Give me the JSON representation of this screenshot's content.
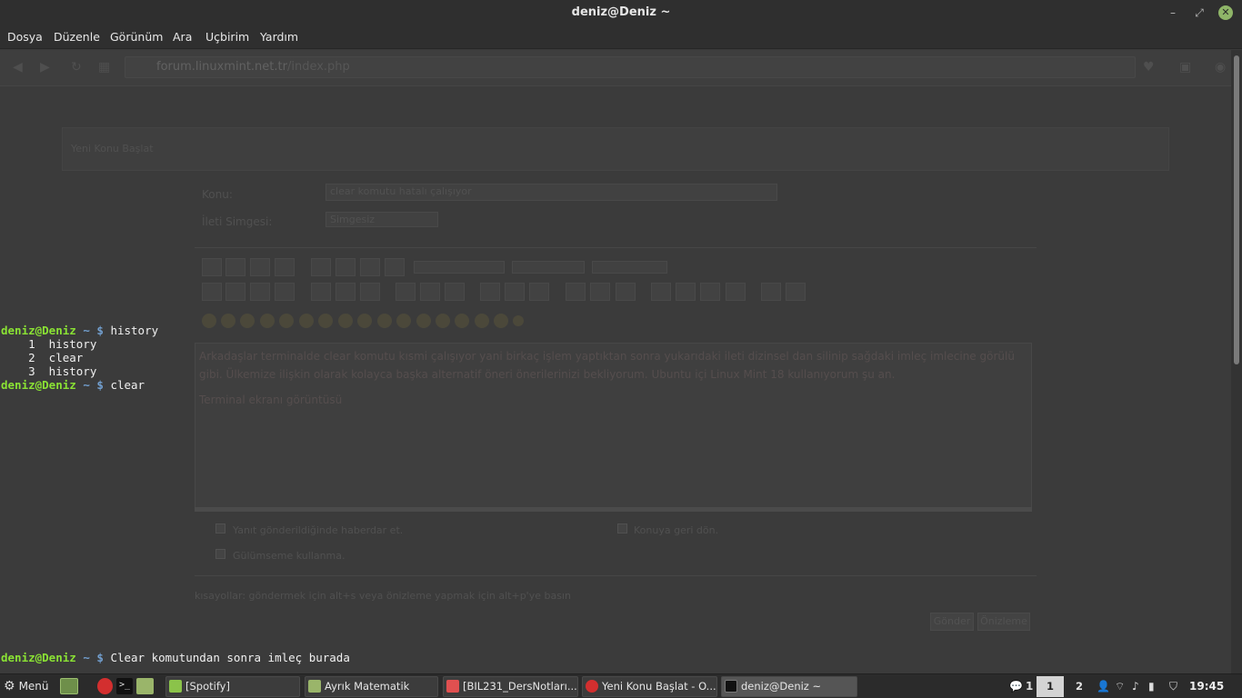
{
  "window": {
    "title": "deniz@Deniz ~",
    "minimize_glyph": "–",
    "maximize_glyph": "⤢",
    "close_glyph": "✕"
  },
  "menubar": {
    "items": [
      "Dosya",
      "Düzenle",
      "Görünüm",
      "Ara",
      "Uçbirim",
      "Yardım"
    ]
  },
  "background_browser": {
    "url_domain": "forum.linuxmint.net.tr",
    "url_path": "/index.php",
    "header_title": "Yeni Konu Başlat",
    "subject_label": "Konu:",
    "subject_value": "clear komutu hatalı çalışıyor",
    "icon_label": "İleti Simgesi:",
    "icon_value": "Simgesiz",
    "message_text": "Arkadaşlar terminalde clear komutu kısmi çalışıyor yani birkaç işlem yaptıktan sonra yukarıdaki ileti dizinsel dan silinip sağdaki imleç imlecine görülü gibi. Ülkemize ilişkin olarak kolayca başka alternatif öneri önerilerinizi bekliyorum. Ubuntu içi Linux Mint 18 kullanıyorum şu an.",
    "message_text2": "Terminal ekranı görüntüsü",
    "check1": "Yanıt gönderildiğinde haberdar et.",
    "check2": "Konuya geri dön.",
    "check3": "Gülümseme kullanma.",
    "shortcuts": "kısayollar: göndermek için alt+s veya önizleme yapmak için alt+p'ye basın",
    "send": "Gönder",
    "preview": "Önizleme"
  },
  "terminal": {
    "prompt_user": "deniz@Deniz",
    "prompt_dir": "~",
    "prompt_sym": "$",
    "lines": [
      {
        "type": "prompt",
        "cmd": "history"
      },
      {
        "type": "out",
        "text": "    1  history"
      },
      {
        "type": "out",
        "text": "    2  clear"
      },
      {
        "type": "out",
        "text": "    3  history"
      },
      {
        "type": "prompt",
        "cmd": "clear"
      }
    ],
    "last_cmd": "Clear komutundan sonra imleç burada"
  },
  "taskbar": {
    "menu_label": "Menü",
    "windows": [
      {
        "label": "[Spotify]",
        "color": "#8bc34a"
      },
      {
        "label": "Ayrık Matematik",
        "color": "#9ab56a"
      },
      {
        "label": "[BIL231_DersNotları...",
        "color": "#e05050"
      },
      {
        "label": "Yeni Konu Başlat - O...",
        "color": "#d32f2f"
      },
      {
        "label": "deniz@Deniz ~",
        "color": "#222222"
      }
    ],
    "notifications": "1",
    "workspace1": "1",
    "workspace2": "2",
    "clock": "19:45"
  }
}
